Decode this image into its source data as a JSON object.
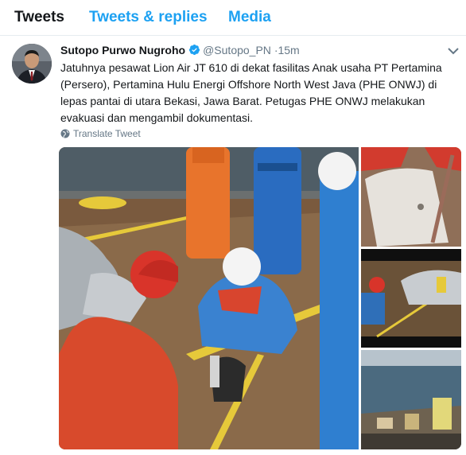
{
  "tabs": [
    {
      "label": "Tweets",
      "active": true
    },
    {
      "label": "Tweets & replies",
      "active": false
    },
    {
      "label": "Media",
      "active": false
    }
  ],
  "tweet": {
    "author_name": "Sutopo Purwo Nugroho",
    "handle": "@Sutopo_PN",
    "separator": "·",
    "time": "15m",
    "verified": true,
    "text": "Jatuhnya pesawat Lion Air JT 610 di dekat fasilitas Anak usaha PT Pertamina (Persero), Pertamina Hulu Energi Offshore North West Java (PHE ONWJ) di lepas pantai di utara Bekasi, Jawa Barat. Petugas PHE ONWJ melakukan evakuasi dan mengambil dokumentasi.",
    "translate_label": "Translate Tweet"
  },
  "colors": {
    "accent": "#1da1f2",
    "text": "#14171a",
    "secondary": "#657786"
  },
  "icons": {
    "verified": "verified-badge-icon",
    "caret": "chevron-down-icon",
    "translate": "globe-icon"
  }
}
